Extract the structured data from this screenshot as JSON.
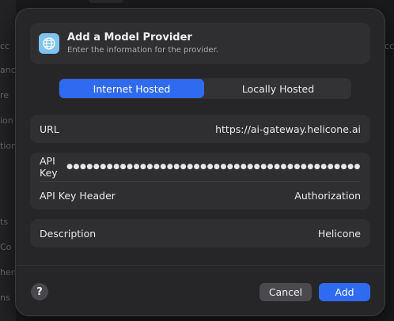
{
  "background": {
    "left_fragments": [
      "cc",
      "anc",
      "re",
      "ion",
      "tion",
      "ts",
      "Co",
      "hen",
      "ns"
    ],
    "right_fragments": [
      "cc"
    ]
  },
  "dialog": {
    "title": "Add a Model Provider",
    "subtitle": "Enter the information for the provider.",
    "icon": "globe-icon",
    "hosting_options": [
      "Internet Hosted",
      "Locally Hosted"
    ],
    "selected_hosting": "Internet Hosted",
    "fields": {
      "url": {
        "label": "URL",
        "value": "https://ai-gateway.helicone.ai"
      },
      "api_key": {
        "label": "API Key",
        "value": "●●●●●●●●●●●●●●●●●●●●●●●●●●●●●●●●●●●●●●●●●●●●"
      },
      "api_key_header": {
        "label": "API Key Header",
        "value": "Authorization"
      },
      "description": {
        "label": "Description",
        "value": "Helicone"
      }
    },
    "help_label": "?",
    "cancel_label": "Cancel",
    "add_label": "Add"
  },
  "colors": {
    "accent": "#2f6bf1",
    "sheet_bg": "#262628",
    "group_bg": "#2f2f31",
    "icon_bg": "#7fc3f0"
  }
}
